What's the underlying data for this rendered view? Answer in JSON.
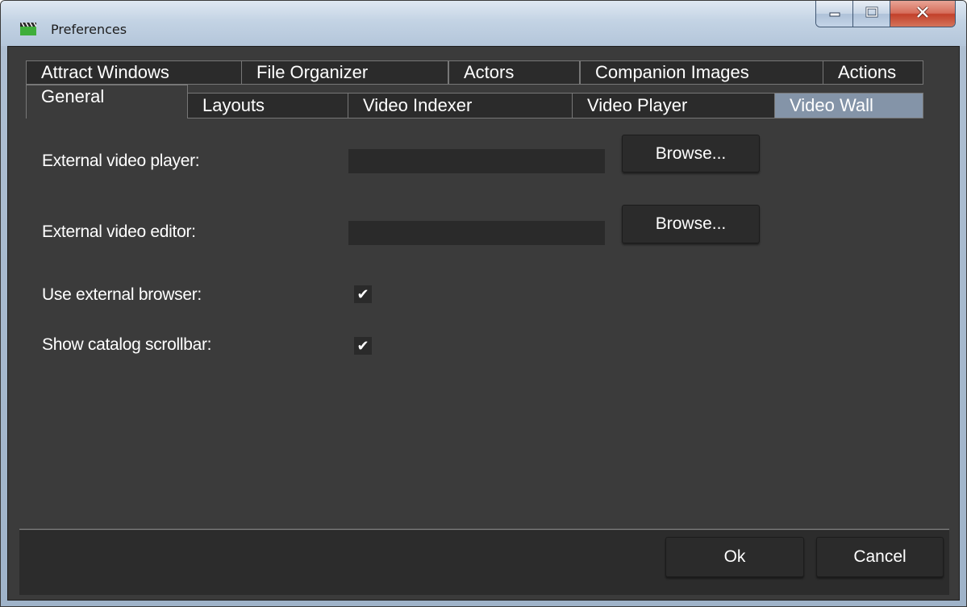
{
  "window": {
    "title": "Preferences",
    "app_icon": "clapperboard-icon",
    "caption_buttons": [
      "minimize-icon",
      "maximize-icon",
      "close-icon"
    ]
  },
  "tabs": {
    "row1": [
      "Attract Windows",
      "File Organizer",
      "Actors",
      "Companion Images",
      "Actions"
    ],
    "row2": [
      "General",
      "Layouts",
      "Video Indexer",
      "Video Player",
      "Video Wall"
    ],
    "selected": "General"
  },
  "general": {
    "external_video_player": {
      "label": "External video player:",
      "value": "",
      "browse": "Browse..."
    },
    "external_video_editor": {
      "label": "External video editor:",
      "value": "",
      "browse": "Browse..."
    },
    "use_external_browser": {
      "label": "Use external browser:",
      "checked": true
    },
    "show_catalog_scrollbar": {
      "label": "Show catalog scrollbar:",
      "checked": true
    }
  },
  "footer": {
    "ok": "Ok",
    "cancel": "Cancel"
  },
  "colors": {
    "background": "#3b3b3b",
    "field": "#2a2a2a",
    "tab_highlight": "#8494a8",
    "text": "#ffffff"
  }
}
